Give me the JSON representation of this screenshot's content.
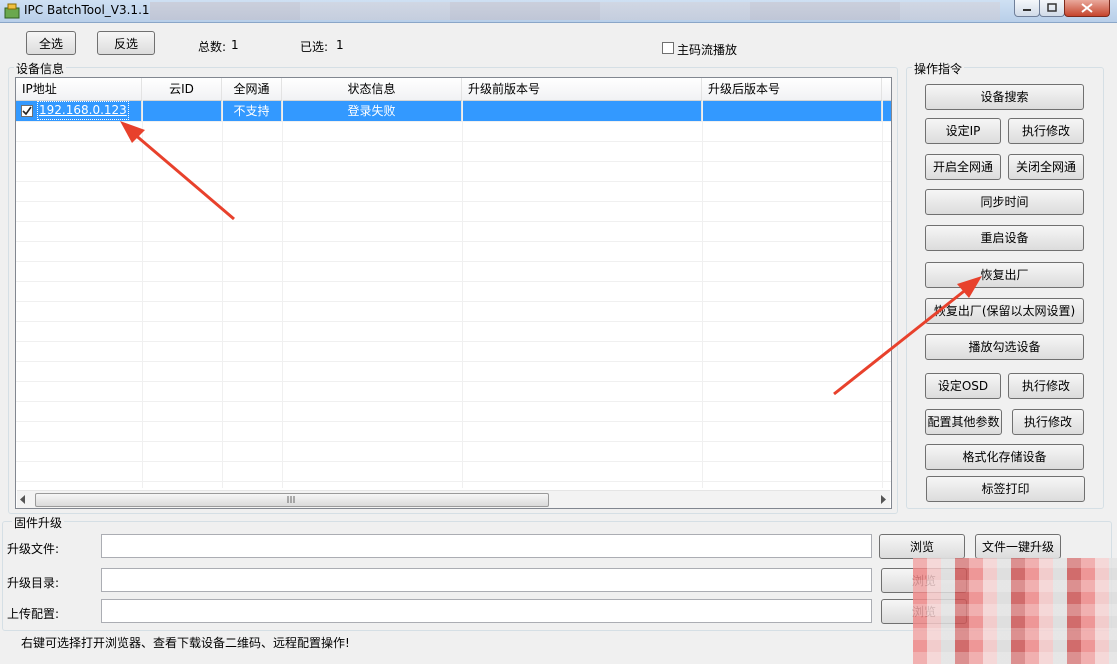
{
  "window": {
    "title": "IPC BatchTool_V3.1.1"
  },
  "toolbar": {
    "select_all": "全选",
    "invert": "反选",
    "total_label": "总数:",
    "total_value": "1",
    "selected_label": "已选:",
    "selected_value": "1",
    "main_stream_label": "主码流播放"
  },
  "device_group": {
    "title": "设备信息",
    "columns": [
      "IP地址",
      "云ID",
      "全网通",
      "状态信息",
      "升级前版本号",
      "升级后版本号"
    ],
    "rows": [
      {
        "checked": true,
        "ip": "192.168.0.123",
        "cloud_id": "",
        "all_net": "不支持",
        "status": "登录失败",
        "before": "",
        "after": ""
      }
    ]
  },
  "ops": {
    "title": "操作指令",
    "device_search": "设备搜索",
    "set_ip": "设定IP",
    "exec_modify_1": "执行修改",
    "enable_allnet": "开启全网通",
    "disable_allnet": "关闭全网通",
    "sync_time": "同步时间",
    "reboot": "重启设备",
    "factory_reset": "恢复出厂",
    "factory_reset_keep": "恢复出厂(保留以太网设置)",
    "play_checked": "播放勾选设备",
    "set_osd": "设定OSD",
    "exec_modify_2": "执行修改",
    "config_other": "配置其他参数",
    "exec_modify_3": "执行修改",
    "format_storage": "格式化存储设备",
    "print_label": "标签打印"
  },
  "firmware": {
    "title": "固件升级",
    "file_label": "升级文件:",
    "dir_label": "升级目录:",
    "config_label": "上传配置:",
    "browse": "浏览",
    "one_click": "文件一键升级"
  },
  "status_bar": {
    "hint": "右键可选择打开浏览器、查看下载设备二维码、远程配置操作!"
  },
  "colors": {
    "selection": "#3399ff",
    "arrow": "#e8412c",
    "link": "#ffffff"
  }
}
